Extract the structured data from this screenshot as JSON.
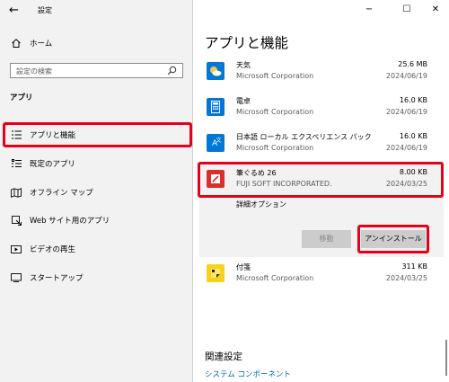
{
  "window": {
    "title": "設定",
    "back_icon": "←",
    "minimize_icon": "−",
    "maximize_icon": "☐",
    "close_icon": "✕"
  },
  "sidebar": {
    "home_label": "ホーム",
    "search_placeholder": "設定の検索",
    "section_title": "アプリ",
    "items": [
      {
        "label": "アプリと機能",
        "icon": "apps-features-icon",
        "active": true
      },
      {
        "label": "既定のアプリ",
        "icon": "default-apps-icon",
        "active": false
      },
      {
        "label": "オフライン マップ",
        "icon": "offline-maps-icon",
        "active": false
      },
      {
        "label": "Web サイト用のアプリ",
        "icon": "apps-for-websites-icon",
        "active": false
      },
      {
        "label": "ビデオの再生",
        "icon": "video-playback-icon",
        "active": false
      },
      {
        "label": "スタートアップ",
        "icon": "startup-icon",
        "active": false
      }
    ]
  },
  "main": {
    "page_title": "アプリと機能",
    "apps": [
      {
        "name": "天気",
        "publisher": "Microsoft Corporation",
        "size": "25.6 MB",
        "date": "2024/06/19",
        "icon": "weather-icon",
        "icon_color": "#0078d7"
      },
      {
        "name": "電卓",
        "publisher": "Microsoft Corporation",
        "size": "16.0 KB",
        "date": "2024/06/19",
        "icon": "calculator-icon",
        "icon_color": "#0078d7"
      },
      {
        "name": "日本語 ローカル エクスペリエンス パック",
        "publisher": "Microsoft Corporation",
        "size": "16.0 KB",
        "date": "2024/06/19",
        "icon": "language-pack-icon",
        "icon_color": "#0078d7"
      },
      {
        "name": "筆ぐるめ 26",
        "publisher": "FUJI SOFT INCORPORATED.",
        "size": "8.00 KB",
        "date": "2024/03/25",
        "icon": "fudegurume-icon",
        "icon_color": "#d9302c",
        "selected": true
      },
      {
        "name": "付箋",
        "publisher": "Microsoft Corporation",
        "size": "311 KB",
        "date": "2024/03/25",
        "icon": "sticky-notes-icon",
        "icon_color": "#f7d21c"
      }
    ],
    "advanced_options": "詳細オプション",
    "move_button": "移動",
    "uninstall_button": "アンインストール",
    "related_settings_title": "関連設定",
    "related_link": "システム コンポーネント"
  },
  "colors": {
    "highlight_red": "#e6001c",
    "accent_blue": "#0063b1"
  }
}
